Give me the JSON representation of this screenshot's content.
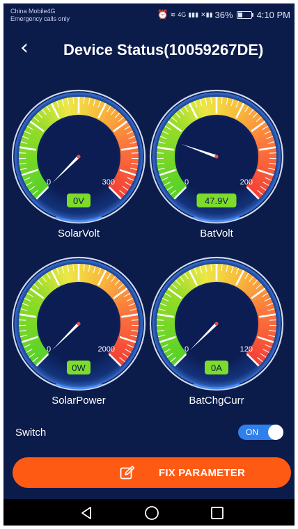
{
  "status_bar": {
    "carrier": "China Mobile4G",
    "emergency": "Emergency calls only",
    "network_4g": "4G",
    "battery_text": "36%",
    "battery_level": 0.36,
    "time": "4:10 PM"
  },
  "header": {
    "back_icon": "chevron-left-icon",
    "title": "Device Status(10059267DE)"
  },
  "gauges": [
    {
      "name": "SolarVolt",
      "min_label": "0",
      "max_label": "300",
      "max": 300,
      "value": 0,
      "value_text": "0V"
    },
    {
      "name": "BatVolt",
      "min_label": "0",
      "max_label": "200",
      "max": 200,
      "value": 47.9,
      "value_text": "47.9V"
    },
    {
      "name": "SolarPower",
      "min_label": "0",
      "max_label": "2000",
      "max": 2000,
      "value": 0,
      "value_text": "0W"
    },
    {
      "name": "BatChgCurr",
      "min_label": "0",
      "max_label": "120",
      "max": 120,
      "value": 0,
      "value_text": "0A"
    }
  ],
  "switch": {
    "label": "Switch",
    "state": "ON"
  },
  "fix_button": {
    "label": "FIX PARAMETER",
    "icon": "edit-icon"
  },
  "colors": {
    "background": "#0b1b4a",
    "accent": "#ff5a14",
    "toggle": "#2f80ed",
    "badge": "#7ddc2a"
  }
}
